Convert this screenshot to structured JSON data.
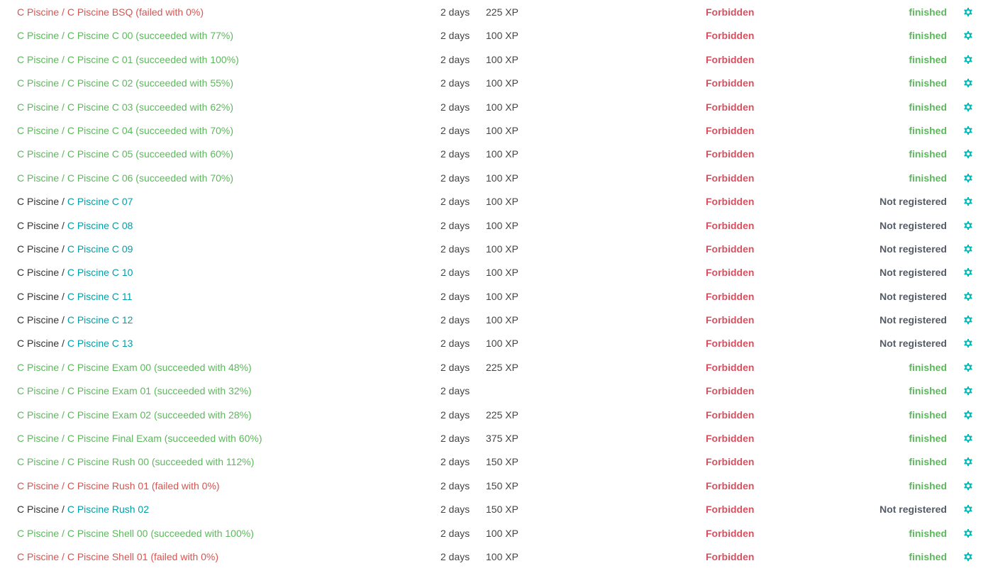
{
  "colors": {
    "succeeded": "#5cb85c",
    "failed": "#d9534f",
    "link": "#00a0a8",
    "forbidden": "#d8505f",
    "finished": "#5cb85c",
    "not_registered": "#555c66",
    "gear": "#00bab7"
  },
  "icons": {
    "settings": "gear-icon"
  },
  "rows": [
    {
      "state": "failed",
      "parent": "C Piscine",
      "separator": " / ",
      "project": "C Piscine BSQ",
      "result": " (failed with 0%)",
      "duration": "2 days",
      "xp": "225 XP",
      "permission": "Forbidden",
      "status": "finished"
    },
    {
      "state": "succeeded",
      "parent": "C Piscine",
      "separator": " / ",
      "project": "C Piscine C 00",
      "result": " (succeeded with 77%)",
      "duration": "2 days",
      "xp": "100 XP",
      "permission": "Forbidden",
      "status": "finished"
    },
    {
      "state": "succeeded",
      "parent": "C Piscine",
      "separator": " / ",
      "project": "C Piscine C 01",
      "result": " (succeeded with 100%)",
      "duration": "2 days",
      "xp": "100 XP",
      "permission": "Forbidden",
      "status": "finished"
    },
    {
      "state": "succeeded",
      "parent": "C Piscine",
      "separator": " / ",
      "project": "C Piscine C 02",
      "result": " (succeeded with 55%)",
      "duration": "2 days",
      "xp": "100 XP",
      "permission": "Forbidden",
      "status": "finished"
    },
    {
      "state": "succeeded",
      "parent": "C Piscine",
      "separator": " / ",
      "project": "C Piscine C 03",
      "result": " (succeeded with 62%)",
      "duration": "2 days",
      "xp": "100 XP",
      "permission": "Forbidden",
      "status": "finished"
    },
    {
      "state": "succeeded",
      "parent": "C Piscine",
      "separator": " / ",
      "project": "C Piscine C 04",
      "result": " (succeeded with 70%)",
      "duration": "2 days",
      "xp": "100 XP",
      "permission": "Forbidden",
      "status": "finished"
    },
    {
      "state": "succeeded",
      "parent": "C Piscine",
      "separator": " / ",
      "project": "C Piscine C 05",
      "result": " (succeeded with 60%)",
      "duration": "2 days",
      "xp": "100 XP",
      "permission": "Forbidden",
      "status": "finished"
    },
    {
      "state": "succeeded",
      "parent": "C Piscine",
      "separator": " / ",
      "project": "C Piscine C 06",
      "result": " (succeeded with 70%)",
      "duration": "2 days",
      "xp": "100 XP",
      "permission": "Forbidden",
      "status": "finished"
    },
    {
      "state": "neutral",
      "parent": "C Piscine",
      "separator": " / ",
      "project": "C Piscine C 07",
      "result": "",
      "duration": "2 days",
      "xp": "100 XP",
      "permission": "Forbidden",
      "status": "Not registered"
    },
    {
      "state": "neutral",
      "parent": "C Piscine",
      "separator": " / ",
      "project": "C Piscine C 08",
      "result": "",
      "duration": "2 days",
      "xp": "100 XP",
      "permission": "Forbidden",
      "status": "Not registered"
    },
    {
      "state": "neutral",
      "parent": "C Piscine",
      "separator": " / ",
      "project": "C Piscine C 09",
      "result": "",
      "duration": "2 days",
      "xp": "100 XP",
      "permission": "Forbidden",
      "status": "Not registered"
    },
    {
      "state": "neutral",
      "parent": "C Piscine",
      "separator": " / ",
      "project": "C Piscine C 10",
      "result": "",
      "duration": "2 days",
      "xp": "100 XP",
      "permission": "Forbidden",
      "status": "Not registered"
    },
    {
      "state": "neutral",
      "parent": "C Piscine",
      "separator": " / ",
      "project": "C Piscine C 11",
      "result": "",
      "duration": "2 days",
      "xp": "100 XP",
      "permission": "Forbidden",
      "status": "Not registered"
    },
    {
      "state": "neutral",
      "parent": "C Piscine",
      "separator": " / ",
      "project": "C Piscine C 12",
      "result": "",
      "duration": "2 days",
      "xp": "100 XP",
      "permission": "Forbidden",
      "status": "Not registered"
    },
    {
      "state": "neutral",
      "parent": "C Piscine",
      "separator": " / ",
      "project": "C Piscine C 13",
      "result": "",
      "duration": "2 days",
      "xp": "100 XP",
      "permission": "Forbidden",
      "status": "Not registered"
    },
    {
      "state": "succeeded",
      "parent": "C Piscine",
      "separator": " / ",
      "project": "C Piscine Exam 00",
      "result": " (succeeded with 48%)",
      "duration": "2 days",
      "xp": "225 XP",
      "permission": "Forbidden",
      "status": "finished"
    },
    {
      "state": "succeeded",
      "parent": "C Piscine",
      "separator": " / ",
      "project": "C Piscine Exam 01",
      "result": " (succeeded with 32%)",
      "duration": "2 days",
      "xp": "",
      "permission": "Forbidden",
      "status": "finished"
    },
    {
      "state": "succeeded",
      "parent": "C Piscine",
      "separator": " / ",
      "project": "C Piscine Exam 02",
      "result": " (succeeded with 28%)",
      "duration": "2 days",
      "xp": "225 XP",
      "permission": "Forbidden",
      "status": "finished"
    },
    {
      "state": "succeeded",
      "parent": "C Piscine",
      "separator": " / ",
      "project": "C Piscine Final Exam",
      "result": " (succeeded with 60%)",
      "duration": "2 days",
      "xp": "375 XP",
      "permission": "Forbidden",
      "status": "finished"
    },
    {
      "state": "succeeded",
      "parent": "C Piscine",
      "separator": " / ",
      "project": "C Piscine Rush 00",
      "result": " (succeeded with 112%)",
      "duration": "2 days",
      "xp": "150 XP",
      "permission": "Forbidden",
      "status": "finished"
    },
    {
      "state": "failed",
      "parent": "C Piscine",
      "separator": " / ",
      "project": "C Piscine Rush 01",
      "result": " (failed with 0%)",
      "duration": "2 days",
      "xp": "150 XP",
      "permission": "Forbidden",
      "status": "finished"
    },
    {
      "state": "neutral",
      "parent": "C Piscine",
      "separator": " / ",
      "project": "C Piscine Rush 02",
      "result": "",
      "duration": "2 days",
      "xp": "150 XP",
      "permission": "Forbidden",
      "status": "Not registered"
    },
    {
      "state": "succeeded",
      "parent": "C Piscine",
      "separator": " / ",
      "project": "C Piscine Shell 00",
      "result": " (succeeded with 100%)",
      "duration": "2 days",
      "xp": "100 XP",
      "permission": "Forbidden",
      "status": "finished"
    },
    {
      "state": "failed",
      "parent": "C Piscine",
      "separator": " / ",
      "project": "C Piscine Shell 01",
      "result": " (failed with 0%)",
      "duration": "2 days",
      "xp": "100 XP",
      "permission": "Forbidden",
      "status": "finished"
    }
  ]
}
